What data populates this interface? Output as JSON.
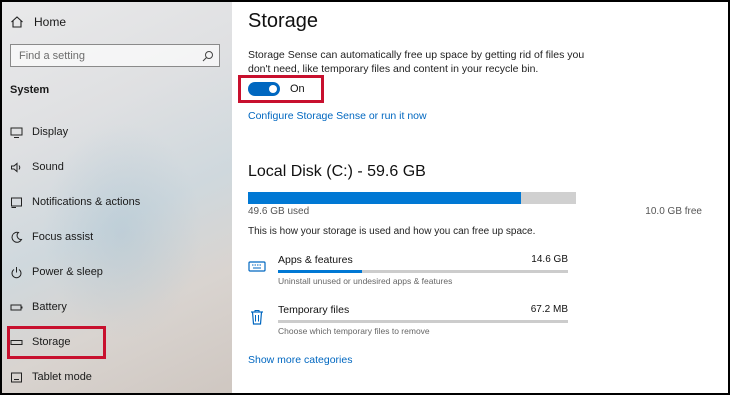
{
  "sidebar": {
    "home_label": "Home",
    "search_placeholder": "Find a setting",
    "section_title": "System",
    "items": [
      {
        "label": "Display",
        "icon": "monitor-icon"
      },
      {
        "label": "Sound",
        "icon": "speaker-icon"
      },
      {
        "label": "Notifications & actions",
        "icon": "notification-icon"
      },
      {
        "label": "Focus assist",
        "icon": "moon-icon"
      },
      {
        "label": "Power & sleep",
        "icon": "power-icon"
      },
      {
        "label": "Battery",
        "icon": "battery-icon"
      },
      {
        "label": "Storage",
        "icon": "storage-icon",
        "selected": true
      },
      {
        "label": "Tablet mode",
        "icon": "tablet-icon"
      }
    ]
  },
  "main": {
    "title": "Storage",
    "description": "Storage Sense can automatically free up space by getting rid of files you don't need, like temporary files and content in your recycle bin.",
    "toggle": {
      "state": "On",
      "on": true
    },
    "configure_link": "Configure Storage Sense or run it now",
    "disk": {
      "title": "Local Disk (C:) - 59.6 GB",
      "used_label": "49.6 GB used",
      "free_label": "10.0 GB free",
      "used_fraction": 0.832
    },
    "usage_text": "This is how your storage is used and how you can free up space.",
    "categories": [
      {
        "name": "Apps & features",
        "size": "14.6 GB",
        "sub": "Uninstall unused or undesired apps & features",
        "icon": "keyboard-icon",
        "fraction": 0.29
      },
      {
        "name": "Temporary files",
        "size": "67.2 MB",
        "sub": "Choose which temporary files to remove",
        "icon": "trash-icon",
        "fraction": 0.0
      }
    ],
    "show_more_link": "Show more categories"
  },
  "colors": {
    "accent": "#0067c0",
    "highlight": "#c8102e",
    "bar_track": "#d0d0d0"
  }
}
